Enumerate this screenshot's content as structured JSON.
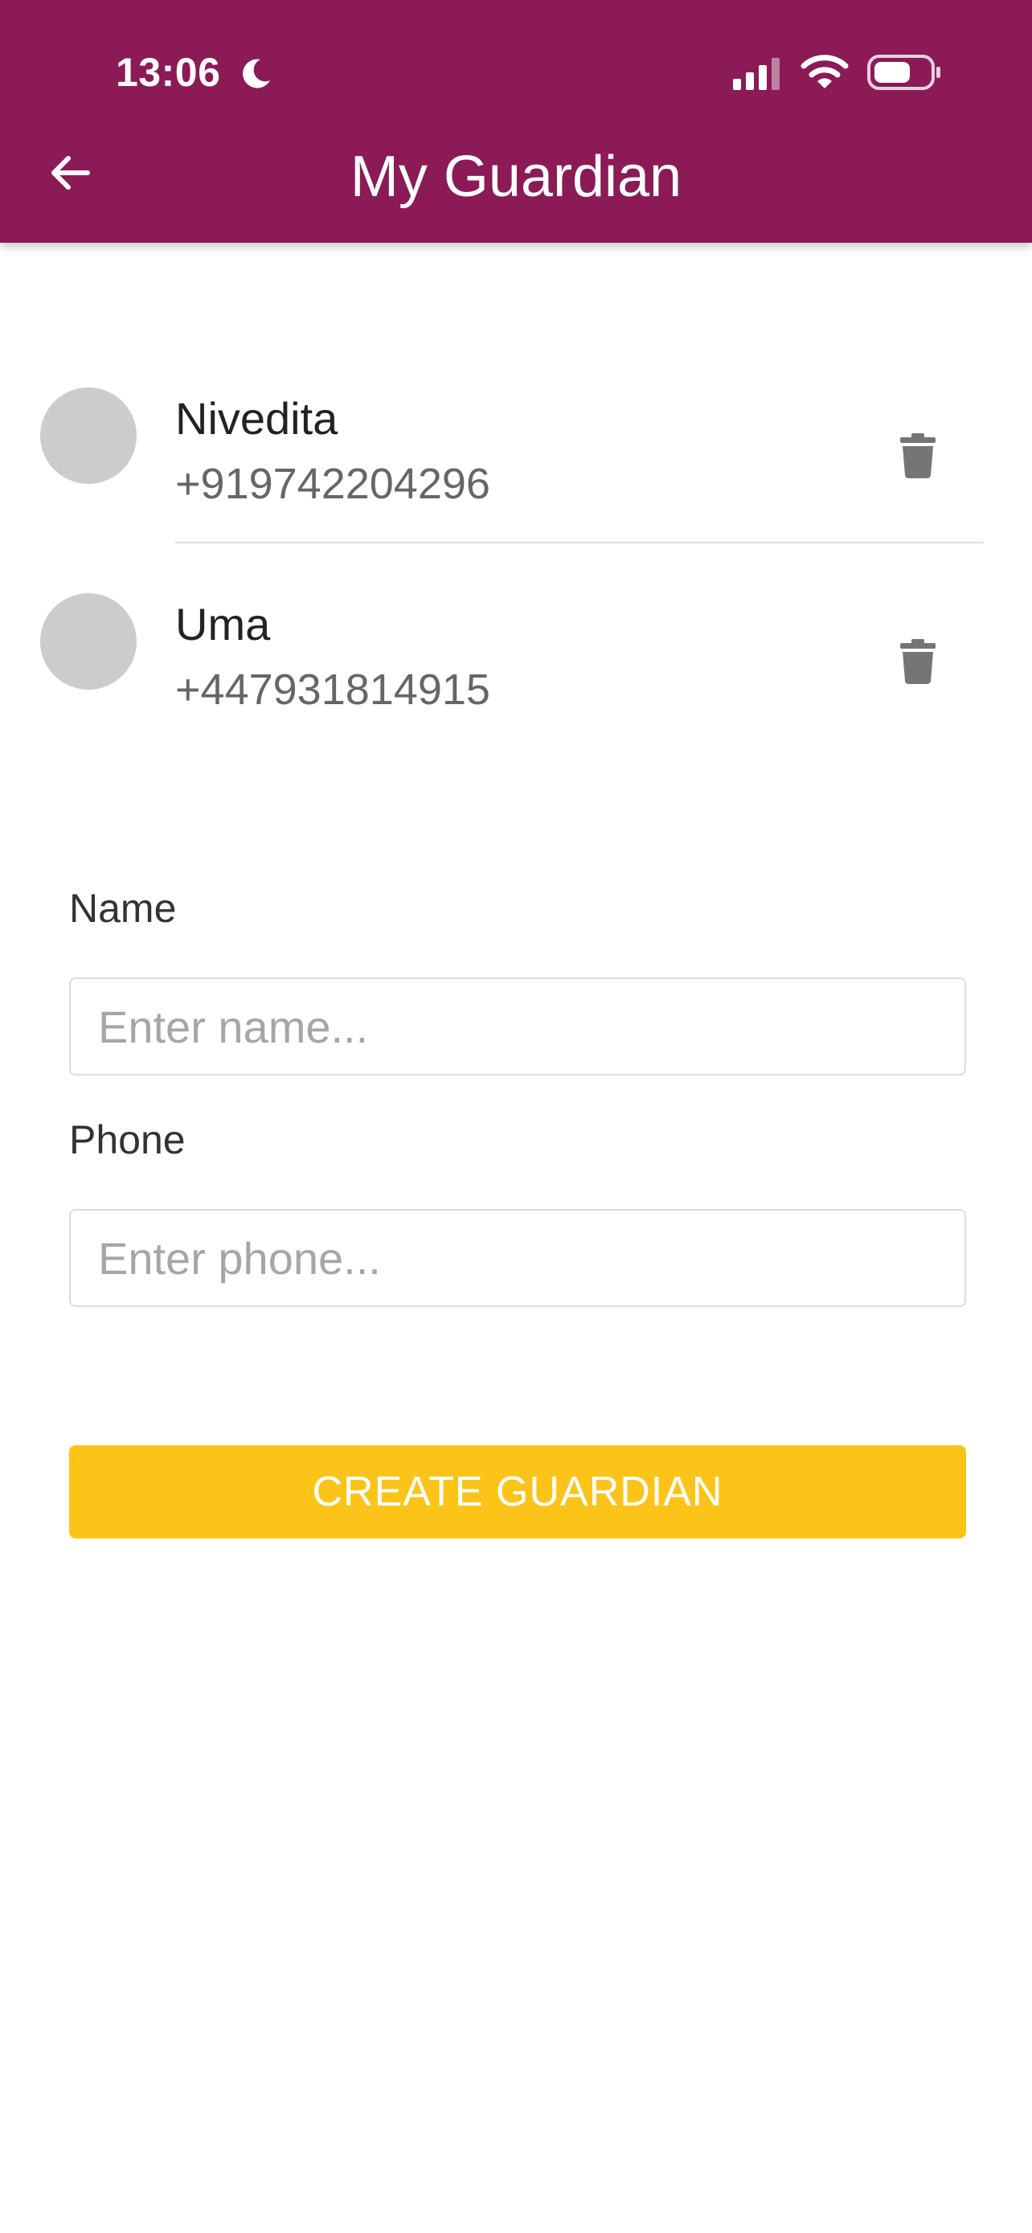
{
  "status_bar": {
    "time": "13:06",
    "icons": [
      "moon-icon",
      "signal-icon",
      "wifi-icon",
      "battery-icon"
    ]
  },
  "header": {
    "title": "My Guardian",
    "back_icon": "arrow-left-icon",
    "background_color": "#8b1a57"
  },
  "guardians": [
    {
      "name": "Nivedita",
      "phone": "+919742204296"
    },
    {
      "name": "Uma",
      "phone": "+447931814915"
    }
  ],
  "form": {
    "name_label": "Name",
    "name_placeholder": "Enter name...",
    "name_value": "",
    "phone_label": "Phone",
    "phone_placeholder": "Enter phone...",
    "phone_value": "",
    "submit_label": "CREATE GUARDIAN",
    "submit_color": "#fcc419"
  }
}
